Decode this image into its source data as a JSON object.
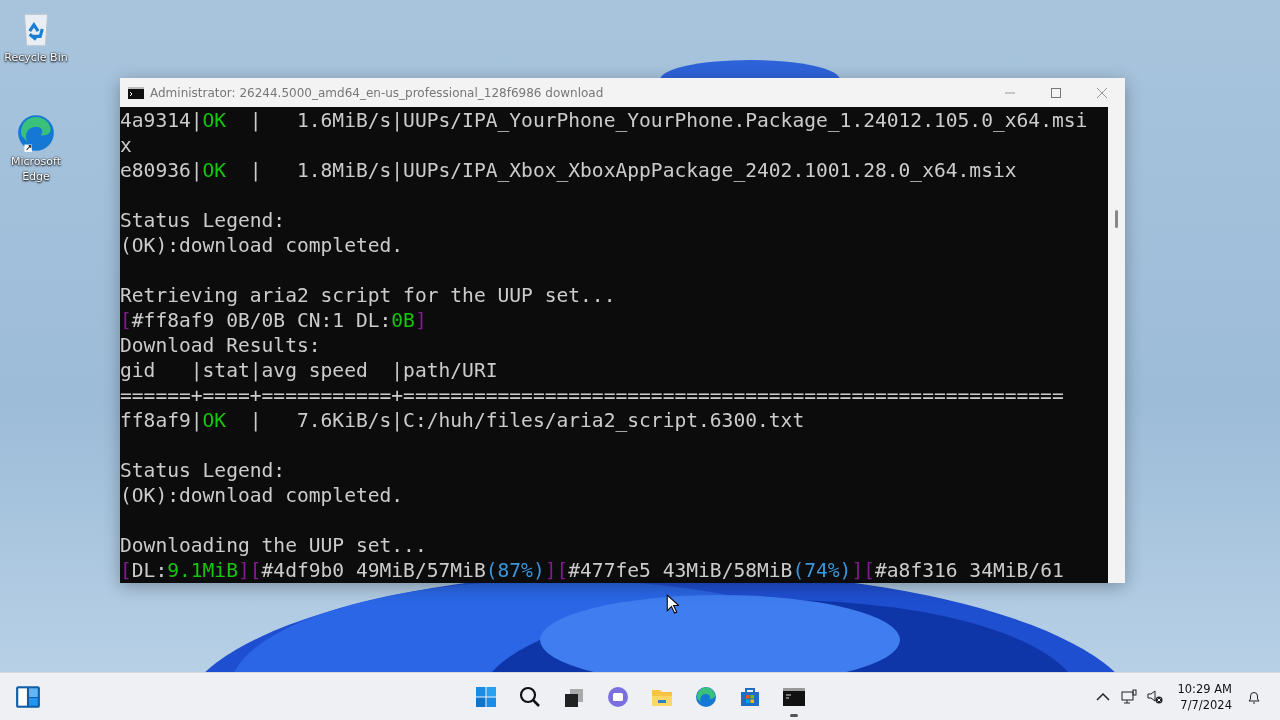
{
  "desktop": {
    "icons": [
      {
        "kind": "recycle",
        "label": "Recycle Bin"
      },
      {
        "kind": "edge",
        "label": "Microsoft Edge"
      }
    ]
  },
  "window": {
    "title": "Administrator:  26244.5000_amd64_en-us_professional_128f6986 download",
    "console": {
      "lines": [
        {
          "kind": "text",
          "segments": [
            {
              "kind": "plain",
              "text": "4a9314|"
            },
            {
              "kind": "ok",
              "text": "OK"
            },
            {
              "kind": "plain",
              "text": "  |   1.6MiB/s|UUPs/IPA_YourPhone_YourPhone.Package_1.24012.105.0_x64.msi"
            }
          ]
        },
        {
          "kind": "text",
          "segments": [
            {
              "kind": "plain",
              "text": "x"
            }
          ]
        },
        {
          "kind": "text",
          "segments": [
            {
              "kind": "plain",
              "text": "e80936|"
            },
            {
              "kind": "ok",
              "text": "OK"
            },
            {
              "kind": "plain",
              "text": "  |   1.8MiB/s|UUPs/IPA_Xbox_XboxAppPackage_2402.1001.28.0_x64.msix"
            }
          ]
        },
        {
          "kind": "blank"
        },
        {
          "kind": "text",
          "segments": [
            {
              "kind": "plain",
              "text": "Status Legend:"
            }
          ]
        },
        {
          "kind": "text",
          "segments": [
            {
              "kind": "plain",
              "text": "(OK):download completed."
            }
          ]
        },
        {
          "kind": "blank"
        },
        {
          "kind": "text",
          "segments": [
            {
              "kind": "plain",
              "text": "Retrieving aria2 script for the UUP set..."
            }
          ]
        },
        {
          "kind": "text",
          "segments": [
            {
              "kind": "bracket",
              "text": "["
            },
            {
              "kind": "plain",
              "text": "#ff8af9 0B/0B CN:1 DL:"
            },
            {
              "kind": "ok",
              "text": "0B"
            },
            {
              "kind": "bracket",
              "text": "]"
            }
          ]
        },
        {
          "kind": "text",
          "segments": [
            {
              "kind": "plain",
              "text": "Download Results:"
            }
          ]
        },
        {
          "kind": "text",
          "segments": [
            {
              "kind": "plain",
              "text": "gid   |stat|avg speed  |path/URI"
            }
          ]
        },
        {
          "kind": "text",
          "segments": [
            {
              "kind": "plain",
              "text": "======+====+===========+========================================================"
            }
          ]
        },
        {
          "kind": "text",
          "segments": [
            {
              "kind": "plain",
              "text": "ff8af9|"
            },
            {
              "kind": "ok",
              "text": "OK"
            },
            {
              "kind": "plain",
              "text": "  |   7.6KiB/s|C:/huh/files/aria2_script.6300.txt"
            }
          ]
        },
        {
          "kind": "blank"
        },
        {
          "kind": "text",
          "segments": [
            {
              "kind": "plain",
              "text": "Status Legend:"
            }
          ]
        },
        {
          "kind": "text",
          "segments": [
            {
              "kind": "plain",
              "text": "(OK):download completed."
            }
          ]
        },
        {
          "kind": "blank"
        },
        {
          "kind": "text",
          "segments": [
            {
              "kind": "plain",
              "text": "Downloading the UUP set..."
            }
          ]
        },
        {
          "kind": "text",
          "segments": [
            {
              "kind": "bracket",
              "text": "["
            },
            {
              "kind": "plain",
              "text": "DL:"
            },
            {
              "kind": "ok",
              "text": "9.1MiB"
            },
            {
              "kind": "bracket",
              "text": "]["
            },
            {
              "kind": "plain",
              "text": "#4df9b0 49MiB/57MiB"
            },
            {
              "kind": "info",
              "text": "(87%)"
            },
            {
              "kind": "bracket",
              "text": "]["
            },
            {
              "kind": "plain",
              "text": "#477fe5 43MiB/58MiB"
            },
            {
              "kind": "info",
              "text": "(74%)"
            },
            {
              "kind": "bracket",
              "text": "]["
            },
            {
              "kind": "plain",
              "text": "#a8f316 34MiB/61"
            }
          ]
        }
      ]
    }
  },
  "taskbar": {
    "apps": [
      {
        "kind": "start",
        "running": false
      },
      {
        "kind": "search",
        "running": false
      },
      {
        "kind": "taskview",
        "running": false
      },
      {
        "kind": "chat",
        "running": false
      },
      {
        "kind": "explorer",
        "running": false
      },
      {
        "kind": "edge",
        "running": false
      },
      {
        "kind": "store",
        "running": false
      },
      {
        "kind": "terminal",
        "running": true
      }
    ],
    "clock": {
      "time": "10:29 AM",
      "date": "7/7/2024"
    }
  }
}
